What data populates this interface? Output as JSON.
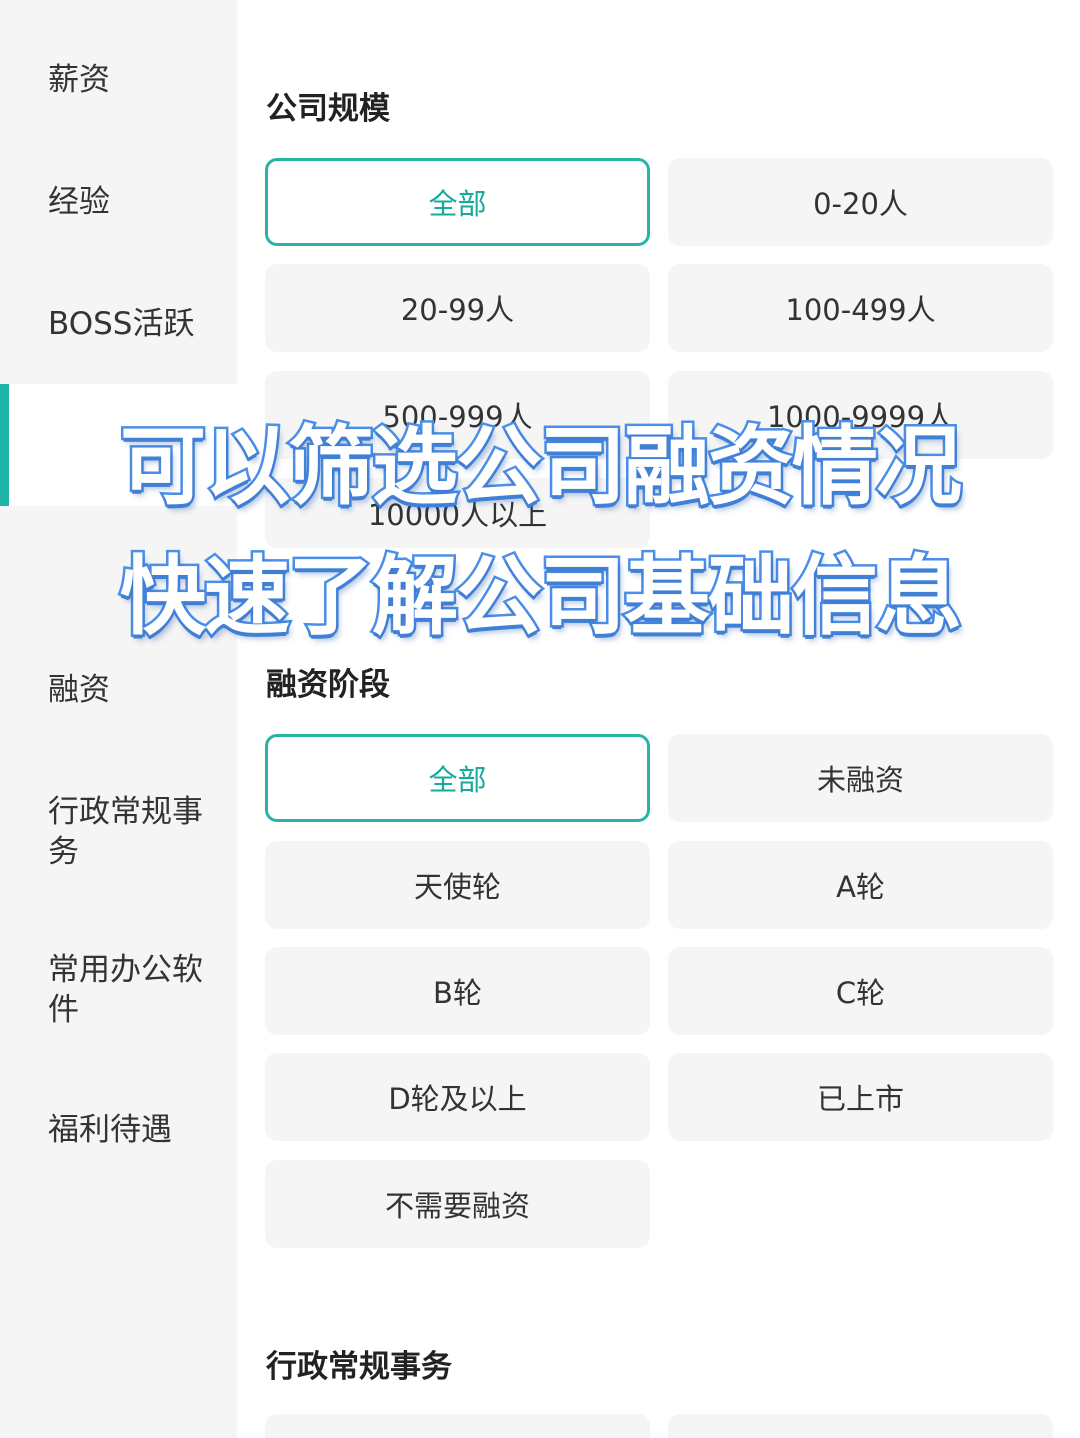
{
  "sidebar": {
    "items": [
      {
        "label": "薪资"
      },
      {
        "label": "经验"
      },
      {
        "label": "BOSS活跃"
      },
      {
        "label": "融资"
      },
      {
        "label": "行政常规事务"
      },
      {
        "label": "常用办公软件"
      },
      {
        "label": "福利待遇"
      }
    ],
    "accent_color": "#1fb5a6"
  },
  "company_size": {
    "title": "公司规模",
    "options": [
      "全部",
      "0-20人",
      "20-99人",
      "100-499人",
      "500-999人",
      "1000-9999人",
      "10000人以上"
    ],
    "selected": "全部"
  },
  "financing": {
    "title": "融资阶段",
    "options": [
      "全部",
      "未融资",
      "天使轮",
      "A轮",
      "B轮",
      "C轮",
      "D轮及以上",
      "已上市",
      "不需要融资"
    ],
    "selected": "全部"
  },
  "admin": {
    "title": "行政常规事务"
  },
  "overlay": {
    "line1": "可以筛选公司融资情况",
    "line2": "快速了解公司基础信息"
  },
  "colors": {
    "active_border": "#28b3a6",
    "active_text": "#17a999",
    "option_bg": "#f5f5f5",
    "overlay_stroke": "#4b8fe8"
  }
}
